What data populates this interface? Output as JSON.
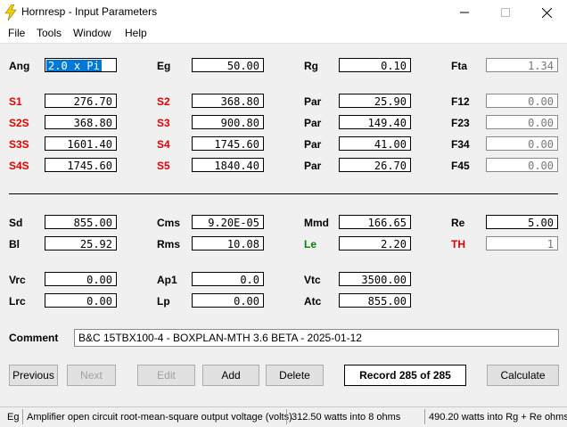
{
  "window": {
    "title": "Hornresp - Input Parameters"
  },
  "menu": {
    "file": "File",
    "tools": "Tools",
    "window": "Window",
    "help": "Help"
  },
  "labels": {
    "ang": "Ang",
    "eg": "Eg",
    "rg": "Rg",
    "fta": "Fta",
    "s1": "S1",
    "s2": "S2",
    "par1": "Par",
    "f12": "F12",
    "s2s": "S2S",
    "s3": "S3",
    "par2": "Par",
    "f23": "F23",
    "s3s": "S3S",
    "s4": "S4",
    "par3": "Par",
    "f34": "F34",
    "s4s": "S4S",
    "s5": "S5",
    "par4": "Par",
    "f45": "F45",
    "sd": "Sd",
    "cms": "Cms",
    "mmd": "Mmd",
    "re": "Re",
    "bl": "Bl",
    "rms": "Rms",
    "le": "Le",
    "th": "TH",
    "vrc": "Vrc",
    "ap1": "Ap1",
    "vtc": "Vtc",
    "lrc": "Lrc",
    "lp": "Lp",
    "atc": "Atc",
    "comment": "Comment"
  },
  "values": {
    "ang": "2.0 x Pi",
    "eg": "50.00",
    "rg": "0.10",
    "fta": "1.34",
    "s1": "276.70",
    "s2": "368.80",
    "par1": "25.90",
    "f12": "0.00",
    "s2s": "368.80",
    "s3": "900.80",
    "par2": "149.40",
    "f23": "0.00",
    "s3s": "1601.40",
    "s4": "1745.60",
    "par3": "41.00",
    "f34": "0.00",
    "s4s": "1745.60",
    "s5": "1840.40",
    "par4": "26.70",
    "f45": "0.00",
    "sd": "855.00",
    "cms": "9.20E-05",
    "mmd": "166.65",
    "re": "5.00",
    "bl": "25.92",
    "rms": "10.08",
    "le": "2.20",
    "th": "1",
    "vrc": "0.00",
    "ap1": "0.0",
    "vtc": "3500.00",
    "lrc": "0.00",
    "lp": "0.00",
    "atc": "855.00",
    "comment": "B&C 15TBX100-4 - BOXPLAN-MTH 3.6 BETA - 2025-01-12"
  },
  "buttons": {
    "previous": "Previous",
    "next": "Next",
    "edit": "Edit",
    "add": "Add",
    "delete": "Delete",
    "calculate": "Calculate"
  },
  "record": "Record 285 of 285",
  "status": {
    "param": "Eg",
    "description": "Amplifier open circuit root-mean-square output voltage  (volts)",
    "power_8ohm": "312.50 watts into 8 ohms",
    "power_rg_re": "490.20 watts into Rg + Re ohms"
  },
  "colors": {
    "red_label": "#e00000",
    "green_label": "#008000",
    "selection": "#0078d7"
  }
}
